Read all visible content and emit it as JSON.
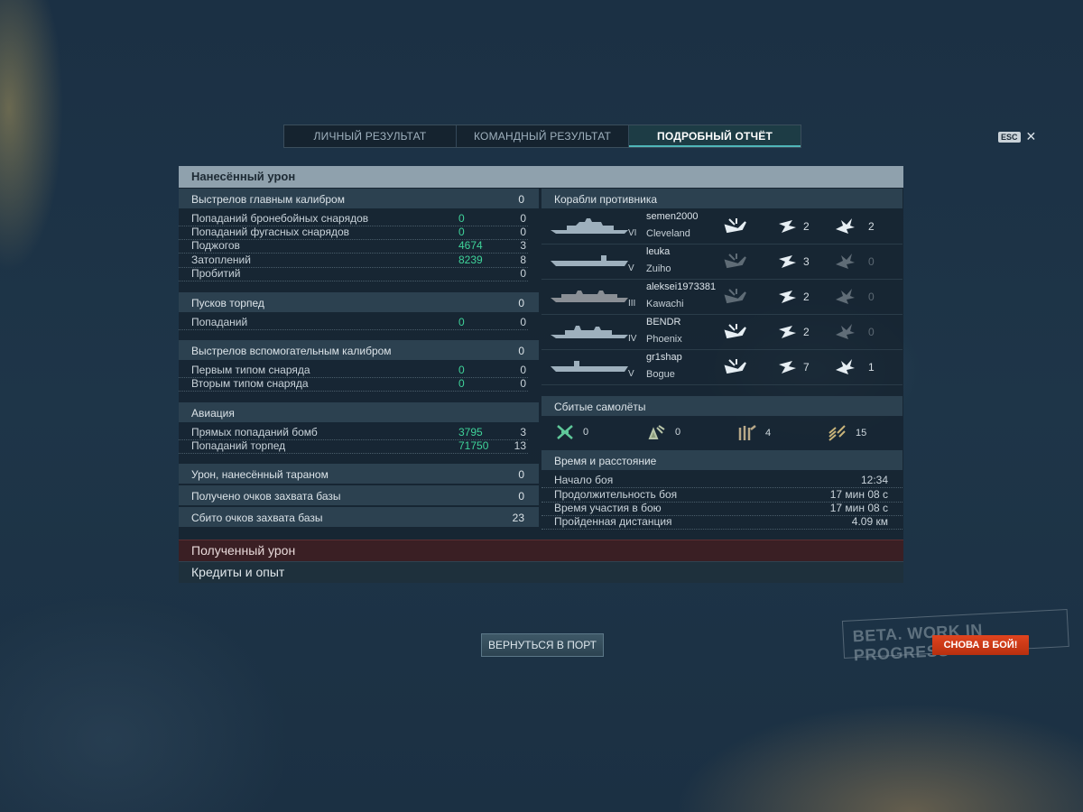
{
  "tabs": [
    "ЛИЧНЫЙ РЕЗУЛЬТАТ",
    "КОМАНДНЫЙ РЕЗУЛЬТАТ",
    "ПОДРОБНЫЙ ОТЧЁТ"
  ],
  "active_tab": 2,
  "esc_label": "ESC",
  "close_glyph": "✕",
  "section_title": "Нанесённый урон",
  "main_caliber": {
    "head": {
      "label": "Выстрелов главным калибром",
      "value": "0"
    },
    "rows": [
      {
        "label": "Попаданий бронебойных снарядов",
        "damage": "0",
        "value": "0"
      },
      {
        "label": "Попаданий фугасных снарядов",
        "damage": "0",
        "value": "0"
      },
      {
        "label": "Поджогов",
        "damage": "4674",
        "value": "3"
      },
      {
        "label": "Затоплений",
        "damage": "8239",
        "value": "8"
      },
      {
        "label": "Пробитий",
        "damage": "",
        "value": "0"
      }
    ]
  },
  "torpedoes": {
    "head": {
      "label": "Пусков торпед",
      "value": "0"
    },
    "rows": [
      {
        "label": "Попаданий",
        "damage": "0",
        "value": "0"
      }
    ]
  },
  "secondary": {
    "head": {
      "label": "Выстрелов вспомогательным калибром",
      "value": "0"
    },
    "rows": [
      {
        "label": "Первым типом снаряда",
        "damage": "0",
        "value": "0"
      },
      {
        "label": "Вторым типом снаряда",
        "damage": "0",
        "value": "0"
      }
    ]
  },
  "aviation": {
    "head": {
      "label": "Авиация",
      "value": ""
    },
    "rows": [
      {
        "label": "Прямых попаданий бомб",
        "damage": "3795",
        "value": "3"
      },
      {
        "label": "Попаданий торпед",
        "damage": "71750",
        "value": "13"
      }
    ]
  },
  "ram": {
    "label": "Урон, нанесённый тараном",
    "value": "0"
  },
  "capture": {
    "label": "Получено очков захвата базы",
    "value": "0"
  },
  "defend": {
    "label": "Сбито очков захвата базы",
    "value": "23"
  },
  "enemy_ships_title": "Корабли противника",
  "ships": [
    {
      "player": "semen2000",
      "ship": "Cleveland",
      "tier": "VI",
      "c1": "2",
      "c2": "2",
      "c2_dim": false
    },
    {
      "player": "leuka",
      "ship": "Zuiho",
      "tier": "V",
      "c1": "3",
      "c2": "0",
      "c2_dim": true
    },
    {
      "player": "aleksei1973381",
      "ship": "Kawachi",
      "tier": "III",
      "c1": "2",
      "c2": "0",
      "c2_dim": true
    },
    {
      "player": "BENDR",
      "ship": "Phoenix",
      "tier": "IV",
      "c1": "2",
      "c2": "0",
      "c2_dim": true
    },
    {
      "player": "gr1shap",
      "ship": "Bogue",
      "tier": "V",
      "c1": "7",
      "c2": "1",
      "c2_dim": false
    }
  ],
  "planes_title": "Сбитые самолёты",
  "planes": [
    {
      "icon": "fighter-icon",
      "count": "0"
    },
    {
      "icon": "torpedo-bomber-icon",
      "count": "0"
    },
    {
      "icon": "dive-bomber-icon",
      "count": "4"
    },
    {
      "icon": "bomber-squad-icon",
      "count": "15"
    }
  ],
  "time_title": "Время и расстояние",
  "time_rows": [
    {
      "label": "Начало боя",
      "value": "12:34"
    },
    {
      "label": "Продолжительность боя",
      "value": "17 мин 08 с"
    },
    {
      "label": "Время участия в бою",
      "value": "17 мин 08 с"
    },
    {
      "label": "Пройденная дистанция",
      "value": "4.09 км"
    }
  ],
  "received_damage": "Полученный урон",
  "credits_xp": "Кредиты и опыт",
  "btn_port": "ВЕРНУТЬСЯ В ПОРТ",
  "btn_battle": "СНОВА В БОЙ!",
  "watermark": "BETA. WORK IN PROGRESS",
  "colors": {
    "accent": "#3fd39a",
    "header": "#8fa1ad",
    "received": "#3a1f24",
    "battle_btn": "#d43c19"
  }
}
